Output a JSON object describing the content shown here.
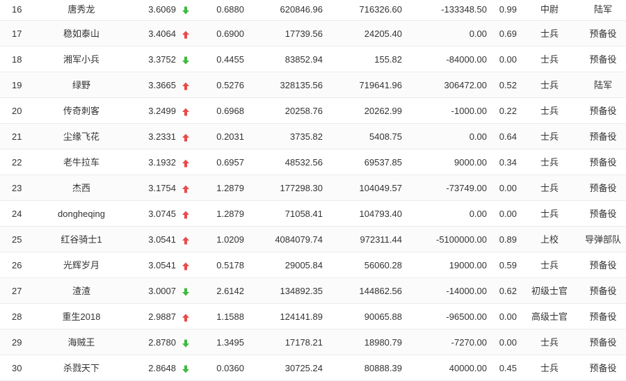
{
  "colors": {
    "up": "#e84a4a",
    "down": "#3dbb3d"
  },
  "rows": [
    {
      "rank": "16",
      "name": "唐秀龙",
      "score": "3.6069",
      "trend": "down",
      "ratio": "0.6880",
      "assets": "620846.96",
      "value": "716326.60",
      "profit": "-133348.50",
      "pct": "0.99",
      "rank_title": "中尉",
      "unit": "陆军"
    },
    {
      "rank": "17",
      "name": "稳如泰山",
      "score": "3.4064",
      "trend": "up",
      "ratio": "0.6900",
      "assets": "17739.56",
      "value": "24205.40",
      "profit": "0.00",
      "pct": "0.69",
      "rank_title": "士兵",
      "unit": "预备役"
    },
    {
      "rank": "18",
      "name": "湘军小兵",
      "score": "3.3752",
      "trend": "down",
      "ratio": "0.4455",
      "assets": "83852.94",
      "value": "155.82",
      "profit": "-84000.00",
      "pct": "0.00",
      "rank_title": "士兵",
      "unit": "预备役"
    },
    {
      "rank": "19",
      "name": "绿野",
      "score": "3.3665",
      "trend": "up",
      "ratio": "0.5276",
      "assets": "328135.56",
      "value": "719641.96",
      "profit": "306472.00",
      "pct": "0.52",
      "rank_title": "士兵",
      "unit": "陆军"
    },
    {
      "rank": "20",
      "name": "传奇刺客",
      "score": "3.2499",
      "trend": "up",
      "ratio": "0.6968",
      "assets": "20258.76",
      "value": "20262.99",
      "profit": "-1000.00",
      "pct": "0.22",
      "rank_title": "士兵",
      "unit": "预备役"
    },
    {
      "rank": "21",
      "name": "尘缘飞花",
      "score": "3.2331",
      "trend": "up",
      "ratio": "0.2031",
      "assets": "3735.82",
      "value": "5408.75",
      "profit": "0.00",
      "pct": "0.64",
      "rank_title": "士兵",
      "unit": "预备役"
    },
    {
      "rank": "22",
      "name": "老牛拉车",
      "score": "3.1932",
      "trend": "up",
      "ratio": "0.6957",
      "assets": "48532.56",
      "value": "69537.85",
      "profit": "9000.00",
      "pct": "0.34",
      "rank_title": "士兵",
      "unit": "预备役"
    },
    {
      "rank": "23",
      "name": "杰西",
      "score": "3.1754",
      "trend": "up",
      "ratio": "1.2879",
      "assets": "177298.30",
      "value": "104049.57",
      "profit": "-73749.00",
      "pct": "0.00",
      "rank_title": "士兵",
      "unit": "预备役"
    },
    {
      "rank": "24",
      "name": "dongheqing",
      "score": "3.0745",
      "trend": "up",
      "ratio": "1.2879",
      "assets": "71058.41",
      "value": "104793.40",
      "profit": "0.00",
      "pct": "0.00",
      "rank_title": "士兵",
      "unit": "预备役"
    },
    {
      "rank": "25",
      "name": "红谷骑士1",
      "score": "3.0541",
      "trend": "up",
      "ratio": "1.0209",
      "assets": "4084079.74",
      "value": "972311.44",
      "profit": "-5100000.00",
      "pct": "0.89",
      "rank_title": "上校",
      "unit": "导弹部队"
    },
    {
      "rank": "26",
      "name": "光辉岁月",
      "score": "3.0541",
      "trend": "up",
      "ratio": "0.5178",
      "assets": "29005.84",
      "value": "56060.28",
      "profit": "19000.00",
      "pct": "0.59",
      "rank_title": "士兵",
      "unit": "预备役"
    },
    {
      "rank": "27",
      "name": "渣渣",
      "score": "3.0007",
      "trend": "down",
      "ratio": "2.6142",
      "assets": "134892.35",
      "value": "144862.56",
      "profit": "-14000.00",
      "pct": "0.62",
      "rank_title": "初级士官",
      "unit": "预备役"
    },
    {
      "rank": "28",
      "name": "重生2018",
      "score": "2.9887",
      "trend": "up",
      "ratio": "1.1588",
      "assets": "124141.89",
      "value": "90065.88",
      "profit": "-96500.00",
      "pct": "0.00",
      "rank_title": "高级士官",
      "unit": "预备役"
    },
    {
      "rank": "29",
      "name": "海贼王",
      "score": "2.8780",
      "trend": "down",
      "ratio": "1.3495",
      "assets": "17178.21",
      "value": "18980.79",
      "profit": "-7270.00",
      "pct": "0.00",
      "rank_title": "士兵",
      "unit": "预备役"
    },
    {
      "rank": "30",
      "name": "杀戮天下",
      "score": "2.8648",
      "trend": "down",
      "ratio": "0.0360",
      "assets": "30725.24",
      "value": "80888.39",
      "profit": "40000.00",
      "pct": "0.45",
      "rank_title": "士兵",
      "unit": "预备役"
    }
  ]
}
